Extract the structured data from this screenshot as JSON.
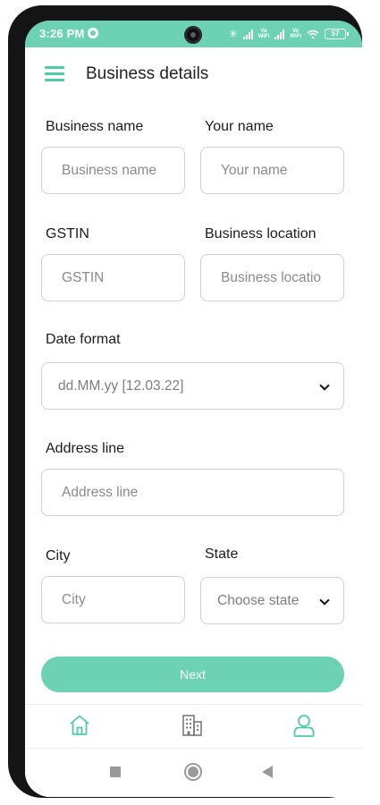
{
  "status_bar": {
    "time": "3:26 PM",
    "network_1": "Vo\nWiFi",
    "network_2": "Vo\nWiFi",
    "battery": "57"
  },
  "header": {
    "title": "Business details",
    "menu_icon": "hamburger-menu-icon"
  },
  "form": {
    "business_name": {
      "label": "Business name",
      "placeholder": "Business name",
      "value": ""
    },
    "your_name": {
      "label": "Your name",
      "placeholder": "Your name",
      "value": ""
    },
    "gstin": {
      "label": "GSTIN",
      "placeholder": "GSTIN",
      "value": ""
    },
    "business_location": {
      "label": "Business location",
      "placeholder": "Business locatio",
      "value": ""
    },
    "date_format": {
      "label": "Date format",
      "selected": "dd.MM.yy [12.03.22]"
    },
    "address_line": {
      "label": "Address line",
      "placeholder": "Address line",
      "value": ""
    },
    "city": {
      "label": "City",
      "placeholder": "City",
      "value": ""
    },
    "state": {
      "label": "State",
      "selected": "Choose state"
    },
    "next_label": "Next"
  },
  "bottom_nav": {
    "items": [
      {
        "icon": "home-icon"
      },
      {
        "icon": "building-icon"
      },
      {
        "icon": "user-icon"
      }
    ]
  },
  "colors": {
    "accent": "#6dd1b4",
    "accent_dark": "#4ecba9",
    "text": "#1b1b1b",
    "border": "#cfcfcf"
  }
}
